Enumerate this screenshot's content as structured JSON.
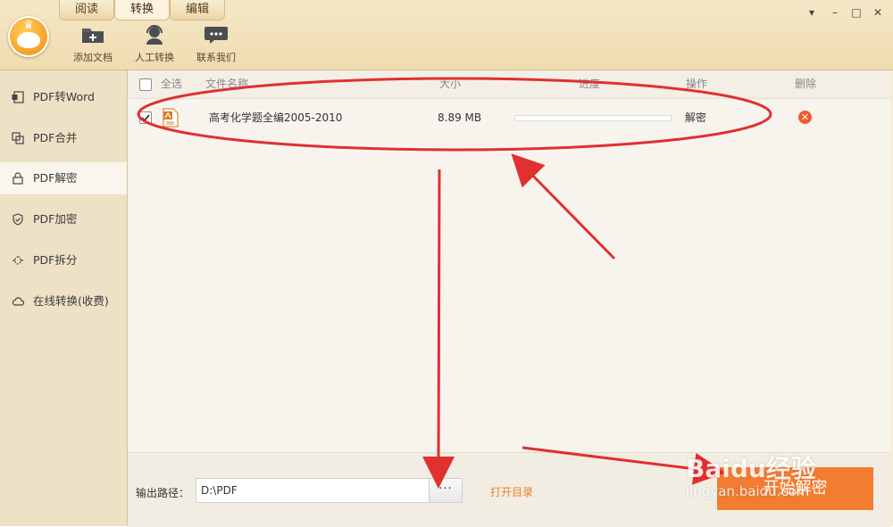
{
  "tabs": [
    {
      "label": "阅读"
    },
    {
      "label": "转换"
    },
    {
      "label": "编辑"
    }
  ],
  "toolbar": {
    "add_doc": {
      "label": "添加文档",
      "icon": "folder-add-icon"
    },
    "manual": {
      "label": "人工转换",
      "icon": "support-agent-icon"
    },
    "contact": {
      "label": "联系我们",
      "icon": "chat-bubble-icon"
    }
  },
  "sidebar": {
    "items": [
      {
        "label": "PDF转Word",
        "icon": "word-doc-icon"
      },
      {
        "label": "PDF合并",
        "icon": "merge-icon"
      },
      {
        "label": "PDF解密",
        "icon": "unlock-icon"
      },
      {
        "label": "PDF加密",
        "icon": "shield-icon"
      },
      {
        "label": "PDF拆分",
        "icon": "split-icon"
      },
      {
        "label": "在线转换(收费)",
        "icon": "cloud-icon"
      }
    ],
    "active_index": 2
  },
  "table": {
    "headers": {
      "select_all": "全选",
      "name": "文件名称",
      "size": "大小",
      "progress": "进度",
      "action": "操作",
      "delete": "删除"
    },
    "rows": [
      {
        "checked": true,
        "name": "高考化学题全编2005-2010",
        "size": "8.89 MB",
        "progress": 0,
        "action": "解密"
      }
    ]
  },
  "footer": {
    "output_label": "输出路径：",
    "output_path": "D:\\PDF",
    "browse_label": "···",
    "open_dir": "打开目录",
    "start_button": "开始解密"
  },
  "watermark": {
    "line1": "Baidu经验",
    "line2": "jingyan.baidu.com"
  },
  "colors": {
    "accent": "#f47c30",
    "delete": "#ef5a2d",
    "annotation": "#e03030",
    "header_bg": "#f2e2bb",
    "sidebar_bg": "#ede2c6"
  }
}
